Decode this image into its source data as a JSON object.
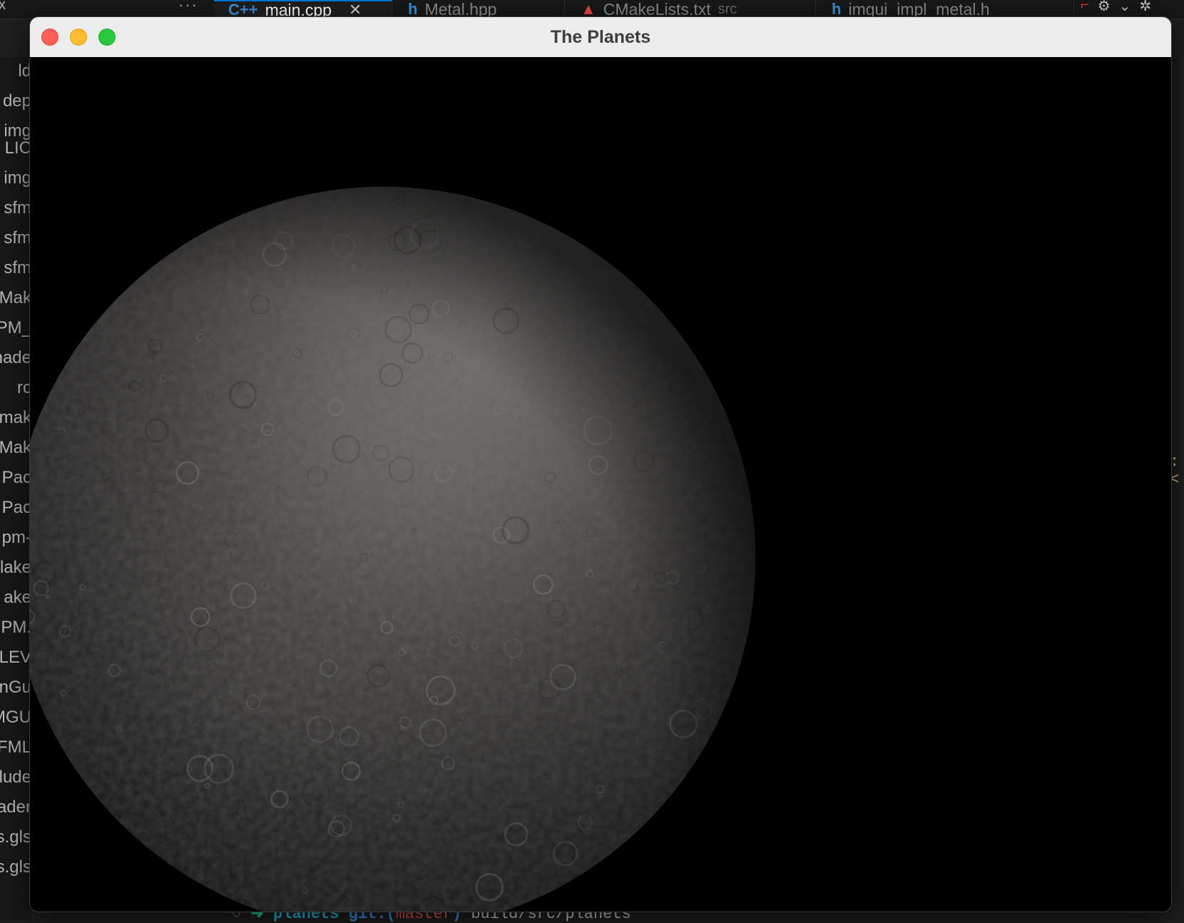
{
  "ide": {
    "top_left_glyph": "x",
    "more_label": "···",
    "tabs": [
      {
        "icon": "C++",
        "label": "main.cpp",
        "description": "",
        "close": "✕",
        "active": true
      },
      {
        "icon": "h",
        "label": "Metal.hpp",
        "description": "",
        "close": "",
        "active": false
      },
      {
        "icon": "▲",
        "label": "CMakeLists.txt",
        "description": "src",
        "close": "",
        "active": false
      },
      {
        "icon": "h",
        "label": "imgui_impl_metal.h",
        "description": "",
        "close": "",
        "active": false
      }
    ],
    "toolbar_icons": [
      "split-editor-icon",
      "debug-run-icon",
      "chevron-down-icon",
      "gear-icon"
    ],
    "explorer_items": [
      "ld",
      "dep",
      "img",
      "LIC",
      "img",
      "sfm",
      "sfm",
      "sfm",
      "Mak",
      "PM_",
      "hade",
      "rc",
      "mak",
      "Mak",
      "Pac",
      "Pac",
      "pm-",
      "lake",
      "ake",
      "PM.",
      "LEV",
      "nGu",
      "MGU",
      "FML",
      "lude",
      "ader",
      "s.gls",
      "s.gls"
    ],
    "right_code_fragment": ":<",
    "terminal": {
      "circle": "○",
      "arrow": "➜",
      "dir": "planets",
      "git_prefix": "git:(",
      "branch": "master",
      "git_suffix": ")",
      "command": "build/src/planets"
    }
  },
  "window": {
    "title": "The Planets"
  },
  "scene": {
    "description_colors": {
      "background": "#000000",
      "lit_surface": "#8f8c88",
      "mid_surface": "#4a4846",
      "dark_surface": "#161514"
    }
  }
}
